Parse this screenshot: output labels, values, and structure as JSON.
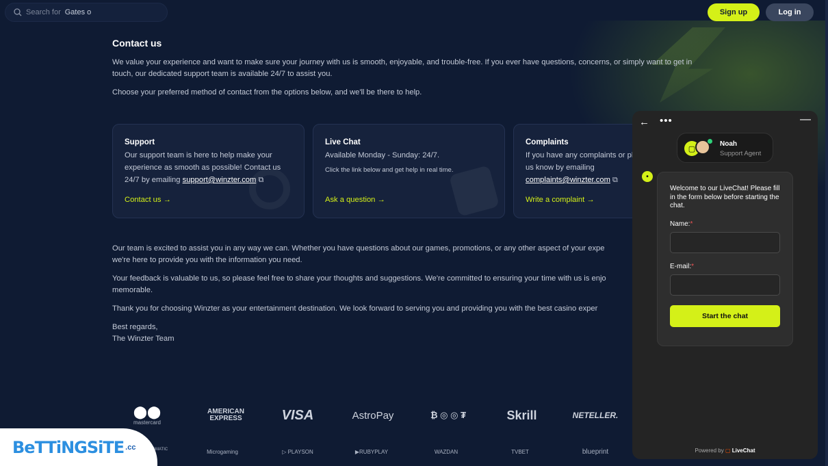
{
  "search": {
    "prefix": "Search for",
    "query": "Gates o"
  },
  "header": {
    "signup_label": "Sign up",
    "login_label": "Log in"
  },
  "page": {
    "title": "Contact us",
    "intro": "We value your experience and want to make sure your journey with us is smooth, enjoyable, and trouble-free. If you ever have questions, concerns, or simply want to get in touch, our dedicated support team is available 24/7 to assist you.",
    "choose": "Choose your preferred method of contact from the options below, and we'll be there to help."
  },
  "cards": [
    {
      "title": "Support",
      "text": "Our support team is here to help make your experience as smooth as possible! Contact us 24/7 by emailing ",
      "email": "support@winzter.com",
      "link": "Contact us →"
    },
    {
      "title": "Live Chat",
      "text": "Available Monday - Sunday: 24/7.",
      "sub": "Click the link below and get help in real time.",
      "link": "Ask a question →"
    },
    {
      "title": "Complaints",
      "text": "If you have any complaints or please let us know by emailing ",
      "email": "complaints@winzter.com",
      "link": "Write a complaint →"
    }
  ],
  "lower": {
    "p1": "Our team is excited to assist you in any way we can. Whether you have questions about our games, promotions, or any other aspect of your expe",
    "p1b": "we're here to provide you with the information you need.",
    "p2": "Your feedback is valuable to us, so please feel free to share your thoughts and suggestions. We're committed to ensuring your time with us is enjo",
    "p2b": "memorable.",
    "p3": "Thank you for choosing Winzter as your entertainment destination. We look forward to serving you and providing you with the best casino exper",
    "sign1": "Best regards,",
    "sign2": "The Winzter Team"
  },
  "payments_row1": [
    "mastercard",
    "AMERICAN EXPRESS",
    "VISA",
    "AstroPay",
    "₿ ◎ ◎ ₮",
    "Skrill",
    "NETELLER."
  ],
  "payments_row2": [
    "PRAGMATIC PLAY",
    "Microgaming",
    "▷ PLAYSON",
    "▶RUBYPLAY",
    "WAZDAN",
    "TVBET",
    "blueprint"
  ],
  "watermark": {
    "brand": "BeTTiNGSiTE",
    "tld": ".cc"
  },
  "chat": {
    "agent_name": "Noah",
    "agent_role": "Support Agent",
    "welcome": "Welcome to our LiveChat! Please fill in the form below before starting the chat.",
    "name_label": "Name:",
    "email_label": "E-mail:",
    "required_mark": "*",
    "start_label": "Start the chat",
    "powered_prefix": "Powered by",
    "powered_brand": "LiveChat"
  },
  "colors": {
    "accent": "#d4f018",
    "bg": "#0f1b33",
    "chat_bg": "#242424"
  }
}
